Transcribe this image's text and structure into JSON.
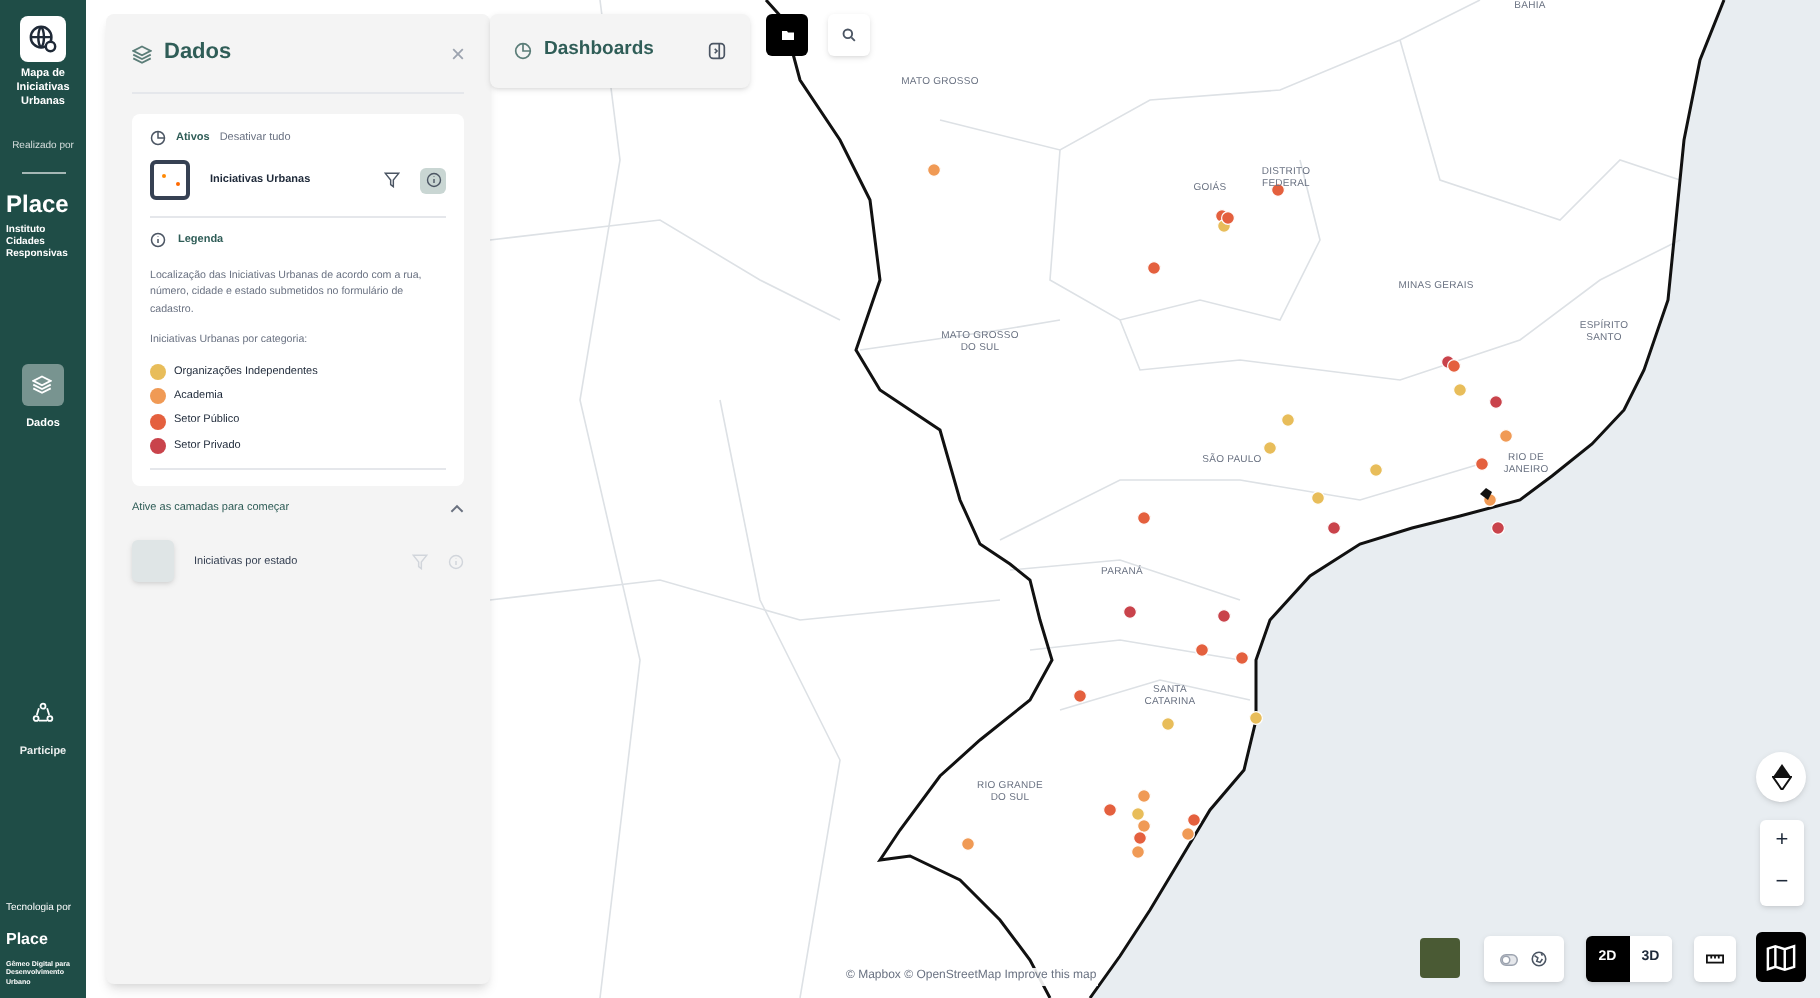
{
  "sidebar": {
    "app_title": "Mapa de Iniciativas Urbanas",
    "credit_label": "Realizado por",
    "credit_brand": "Place",
    "credit_org": "Instituto Cidades Responsivas",
    "nav": [
      {
        "label": "Dados",
        "selected": true
      },
      {
        "label": "Participe",
        "selected": false
      }
    ],
    "footer_label": "Tecnologia por",
    "footer_brand": "Place",
    "footer_tagline": "Gêmeo Digital para Desenvolvimento Urbano"
  },
  "data_panel": {
    "title": "Dados",
    "active": {
      "label": "Ativos",
      "action": "Desativar tudo",
      "layers": [
        {
          "name": "Iniciativas Urbanas",
          "info_selected": true
        }
      ]
    },
    "legend": {
      "title": "Legenda",
      "description": "Localização das Iniciativas Urbanas de acordo com a rua, número, cidade e estado submetidos no formulário de cadastro.",
      "subtitle": "Iniciativas Urbanas por categoria:",
      "items": [
        {
          "label": "Organizações Independentes",
          "color": "#e8bd5a"
        },
        {
          "label": "Academia",
          "color": "#f09a55"
        },
        {
          "label": "Setor Público",
          "color": "#e4603e"
        },
        {
          "label": "Setor Privado",
          "color": "#c9434b"
        }
      ]
    },
    "available": {
      "title": "Ative as camadas para começar",
      "expanded": true,
      "layers": [
        {
          "name": "Iniciativas por estado"
        }
      ]
    }
  },
  "dashboards_tab": {
    "label": "Dashboards"
  },
  "map": {
    "labels": [
      "BAHIA",
      "MATO GROSSO",
      "GOIÁS",
      "DISTRITO FEDERAL",
      "MINAS GERAIS",
      "ESPÍRITO SANTO",
      "MATO GROSSO DO SUL",
      "SÃO PAULO",
      "RIO DE JANEIRO",
      "PARANÁ",
      "SANTA CATARINA",
      "RIO GRANDE DO SUL"
    ],
    "attribution": "© Mapbox © OpenStreetMap Improve this map"
  },
  "map_controls": {
    "terrain_toggle": {
      "on": false
    },
    "view_modes": [
      {
        "label": "2D",
        "selected": true
      },
      {
        "label": "3D",
        "selected": false
      }
    ],
    "zoom_in": "+",
    "zoom_out": "−"
  }
}
